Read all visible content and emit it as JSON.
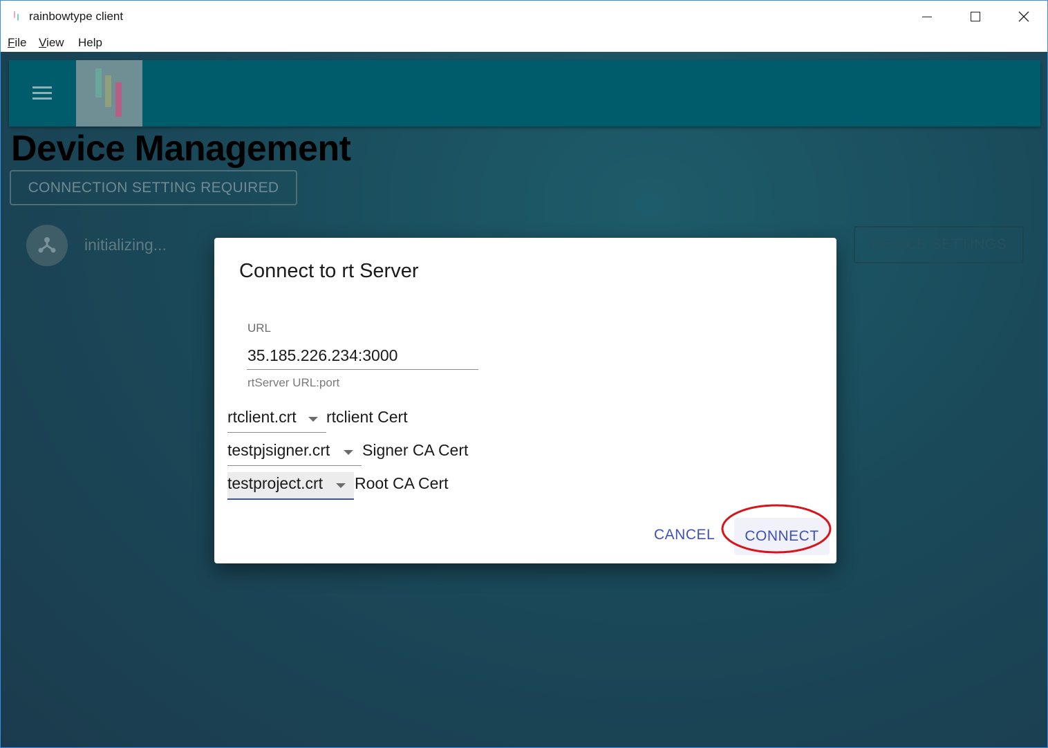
{
  "window": {
    "title": "rainbowtype client"
  },
  "menu": {
    "items": [
      {
        "first": "F",
        "rest": "ile"
      },
      {
        "first": "V",
        "rest": "iew"
      },
      {
        "first": "",
        "rest": "Help"
      }
    ]
  },
  "page": {
    "title": "Device Management",
    "connection_button": "CONNECTION SETTING REQUIRED",
    "status_text": "initializing...",
    "device_settings_button": "DEVICE SETTINGS"
  },
  "dialog": {
    "title": "Connect to rt Server",
    "url_label": "URL",
    "url_value": "35.185.226.234:3000",
    "url_helper": "rtServer URL:port",
    "certs": [
      {
        "value": "rtclient.crt",
        "label": "rtclient Cert"
      },
      {
        "value": "testpjsigner.crt",
        "label": "Signer CA Cert"
      },
      {
        "value": "testproject.crt",
        "label": "Root CA Cert"
      }
    ],
    "cancel_label": "CANCEL",
    "connect_label": "CONNECT"
  },
  "colors": {
    "accent": "#3f51b5",
    "appbar": "#005c6a",
    "highlight": "#d7141a"
  }
}
